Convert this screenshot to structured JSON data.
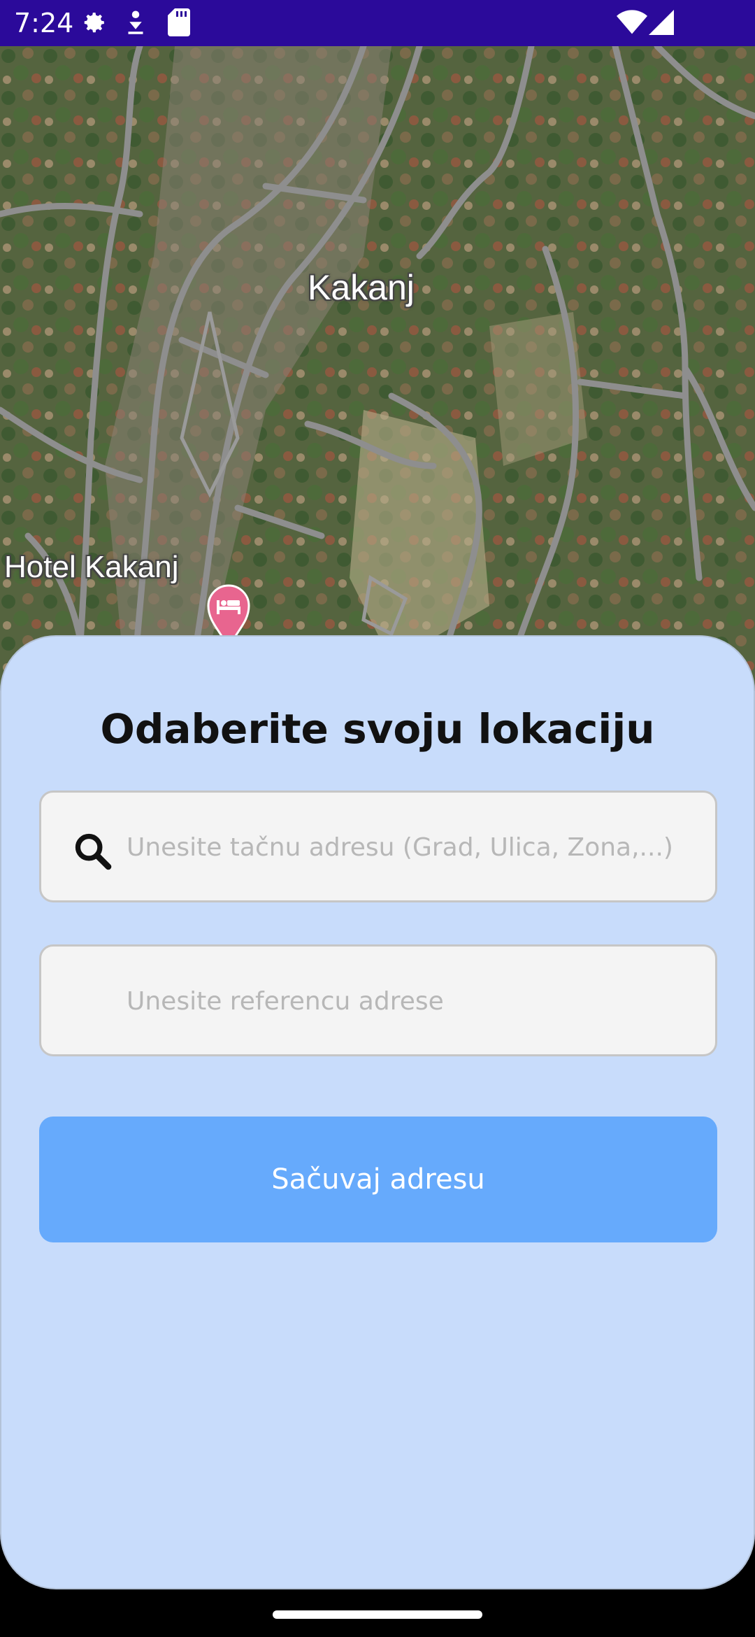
{
  "status_bar": {
    "time": "7:24",
    "icons": [
      "settings-gear-icon",
      "download-notification-icon",
      "sd-card-icon",
      "wifi-icon",
      "cellular-signal-icon"
    ]
  },
  "map": {
    "town_label": "Kakanj",
    "poi_label": "Hotel Kakanj",
    "poi_icon": "hotel-bed-pin-icon",
    "poi_color": "#e8658f"
  },
  "sheet": {
    "title": "Odaberite svoju lokaciju",
    "address_field": {
      "value": "",
      "placeholder": "Unesite tačnu adresu (Grad, Ulica, Zona,...)"
    },
    "reference_field": {
      "value": "",
      "placeholder": "Unesite referencu adrese"
    },
    "save_button_label": "Sačuvaj adresu"
  },
  "colors": {
    "status_bar": "#2b0a9a",
    "sheet_background": "#c8dcfb",
    "button": "#66aafc",
    "field_background": "#f4f4f4"
  }
}
